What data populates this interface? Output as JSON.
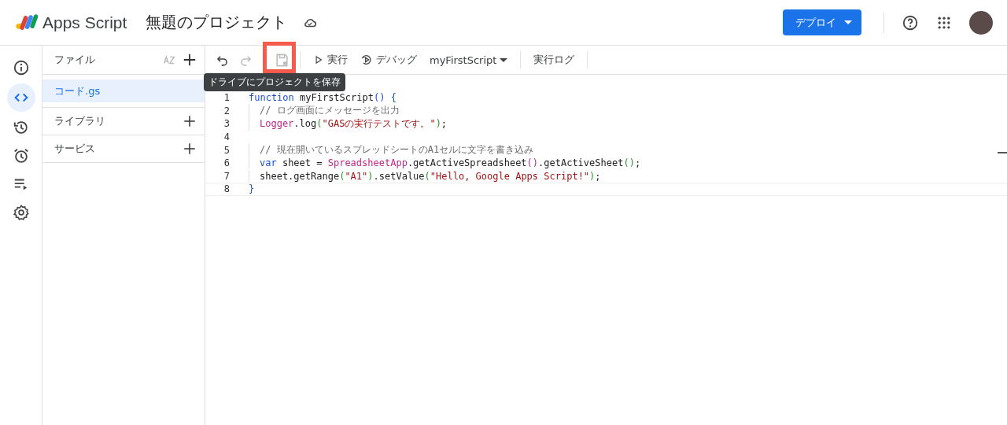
{
  "app": {
    "name": "Apps Script",
    "project_title": "無題のプロジェクト"
  },
  "header": {
    "deploy_button": "デプロイ"
  },
  "rail": [
    {
      "kind": "info",
      "selected": false
    },
    {
      "kind": "code",
      "selected": true
    },
    {
      "kind": "history",
      "selected": false
    },
    {
      "kind": "alarm",
      "selected": false
    },
    {
      "kind": "runlist",
      "selected": false
    },
    {
      "kind": "settings",
      "selected": false
    }
  ],
  "files_panel": {
    "title": "ファイル",
    "files": [
      {
        "name": "コード.gs",
        "selected": true
      }
    ],
    "sections": [
      {
        "title": "ライブラリ"
      },
      {
        "title": "サービス"
      }
    ]
  },
  "toolbar": {
    "tools": [
      {
        "kind": "undo",
        "disabled": false,
        "highlighted": false
      },
      {
        "kind": "redo",
        "disabled": true,
        "highlighted": false
      },
      {
        "kind": "save",
        "disabled": true,
        "highlighted": true
      }
    ],
    "run_button": "実行",
    "debug_button": "デバッグ",
    "function_select": "myFirstScript",
    "log_button": "実行ログ",
    "tooltip": "ドライブにプロジェクトを保存"
  },
  "editor": {
    "lines": [
      {
        "number": "1",
        "current": false,
        "tokens": [
          {
            "kind": "keyword",
            "text": "function"
          },
          {
            "kind": "plain",
            "text": " myFirstScript"
          },
          {
            "kind": "bracket",
            "text": "() {"
          }
        ]
      },
      {
        "number": "2",
        "current": false,
        "indented": true,
        "tokens": [
          {
            "kind": "comment",
            "text": "// ログ画面にメッセージを出力"
          }
        ]
      },
      {
        "number": "3",
        "current": false,
        "indented": true,
        "tokens": [
          {
            "kind": "class",
            "text": "Logger"
          },
          {
            "kind": "plain",
            "text": ".log"
          },
          {
            "kind": "paren",
            "text": "("
          },
          {
            "kind": "string",
            "text": "\"GASの実行テストです。\""
          },
          {
            "kind": "paren",
            "text": ")"
          },
          {
            "kind": "plain",
            "text": ";"
          }
        ]
      },
      {
        "number": "4",
        "current": false
      },
      {
        "number": "5",
        "current": false,
        "indented": true,
        "tokens": [
          {
            "kind": "comment",
            "text": "// 現在開いているスプレッドシートのA1セルに文字を書き込み"
          }
        ]
      },
      {
        "number": "6",
        "current": false,
        "indented": true,
        "tokens": [
          {
            "kind": "keyword",
            "text": "var"
          },
          {
            "kind": "plain",
            "text": " sheet = "
          },
          {
            "kind": "class",
            "text": "SpreadsheetApp"
          },
          {
            "kind": "plain",
            "text": ".getActiveSpreadsheet"
          },
          {
            "kind": "paren2",
            "text": "()"
          },
          {
            "kind": "plain",
            "text": ".getActiveSheet"
          },
          {
            "kind": "paren",
            "text": "()"
          },
          {
            "kind": "plain",
            "text": ";"
          }
        ]
      },
      {
        "number": "7",
        "current": false,
        "indented": true,
        "tokens": [
          {
            "kind": "plain",
            "text": "sheet.getRange"
          },
          {
            "kind": "paren",
            "text": "("
          },
          {
            "kind": "string",
            "text": "\"A1\""
          },
          {
            "kind": "paren",
            "text": ")"
          },
          {
            "kind": "plain",
            "text": ".setValue"
          },
          {
            "kind": "paren",
            "text": "("
          },
          {
            "kind": "string",
            "text": "\"Hello, Google Apps Script!\""
          },
          {
            "kind": "paren",
            "text": ")"
          },
          {
            "kind": "plain",
            "text": ";"
          }
        ]
      },
      {
        "number": "8",
        "current": true,
        "tokens": [
          {
            "kind": "bracket",
            "text": "}"
          }
        ]
      }
    ]
  }
}
